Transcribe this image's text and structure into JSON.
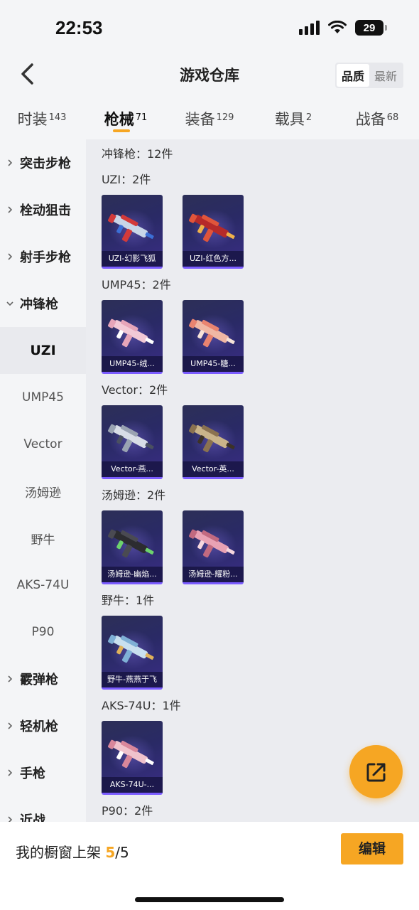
{
  "status_bar": {
    "time": "22:53",
    "battery": "29",
    "icons": [
      "signal-icon",
      "wifi-icon",
      "battery-icon"
    ]
  },
  "header": {
    "title": "游戏仓库",
    "sort_options": [
      {
        "label": "品质",
        "active": true
      },
      {
        "label": "最新",
        "active": false
      }
    ]
  },
  "tabs": [
    {
      "label": "时装",
      "count": "143",
      "active": false
    },
    {
      "label": "枪械",
      "count": "71",
      "active": true
    },
    {
      "label": "装备",
      "count": "129",
      "active": false
    },
    {
      "label": "载具",
      "count": "2",
      "active": false
    },
    {
      "label": "战备",
      "count": "68",
      "active": false
    }
  ],
  "sidebar": {
    "items": [
      {
        "label": "突击步枪",
        "type": "category",
        "expanded": false
      },
      {
        "label": "栓动狙击",
        "type": "category",
        "expanded": false
      },
      {
        "label": "射手步枪",
        "type": "category",
        "expanded": false
      },
      {
        "label": "冲锋枪",
        "type": "category",
        "expanded": true
      },
      {
        "label": "UZI",
        "type": "sub",
        "active": true
      },
      {
        "label": "UMP45",
        "type": "sub",
        "active": false
      },
      {
        "label": "Vector",
        "type": "sub",
        "active": false
      },
      {
        "label": "汤姆逊",
        "type": "sub",
        "active": false
      },
      {
        "label": "野牛",
        "type": "sub",
        "active": false
      },
      {
        "label": "AKS-74U",
        "type": "sub",
        "active": false
      },
      {
        "label": "P90",
        "type": "sub",
        "active": false
      },
      {
        "label": "霰弹枪",
        "type": "category",
        "expanded": false
      },
      {
        "label": "轻机枪",
        "type": "category",
        "expanded": false
      },
      {
        "label": "手枪",
        "type": "category",
        "expanded": false
      },
      {
        "label": "近战",
        "type": "category",
        "expanded": false
      }
    ]
  },
  "content": {
    "category_summary": "冲锋枪：12件",
    "groups": [
      {
        "title": "UZI：2件",
        "items": [
          {
            "label": "UZI-幻影飞狐",
            "palette": [
              "#c8d6e8",
              "#d23a3a",
              "#3b6fd6"
            ]
          },
          {
            "label": "UZI-红色方...",
            "palette": [
              "#b52a2a",
              "#e0553b",
              "#f0b24a"
            ]
          }
        ]
      },
      {
        "title": "UMP45：2件",
        "items": [
          {
            "label": "UMP45-绒...",
            "palette": [
              "#f2c9d6",
              "#e6a5b9",
              "#ffffff"
            ]
          },
          {
            "label": "UMP45-糖...",
            "palette": [
              "#f0b7a4",
              "#e98470",
              "#f6e3d8"
            ]
          }
        ]
      },
      {
        "title": "Vector：2件",
        "items": [
          {
            "label": "Vector-燕...",
            "palette": [
              "#d8dde6",
              "#9aa3b2",
              "#4a5060"
            ]
          },
          {
            "label": "Vector-英...",
            "palette": [
              "#c9b48a",
              "#8a7250",
              "#3c3226"
            ]
          }
        ]
      },
      {
        "title": "汤姆逊：2件",
        "items": [
          {
            "label": "汤姆逊-幽焰...",
            "palette": [
              "#2c2c30",
              "#4a4a52",
              "#6dd36d"
            ]
          },
          {
            "label": "汤姆逊-耀粉...",
            "palette": [
              "#e9a2b4",
              "#c26a80",
              "#f6d7de"
            ]
          }
        ]
      },
      {
        "title": "野牛：1件",
        "items": [
          {
            "label": "野牛-燕燕于飞",
            "palette": [
              "#c9e0ef",
              "#7fb0d6",
              "#e0b25a"
            ]
          }
        ]
      },
      {
        "title": "AKS-74U：1件",
        "items": [
          {
            "label": "AKS-74U-...",
            "palette": [
              "#f0c2cc",
              "#d9879b",
              "#ffffff"
            ]
          }
        ]
      },
      {
        "title": "P90：2件",
        "items": [
          {
            "label": "",
            "palette": [
              "#2c2f57",
              "#3a2e86",
              "#7b5cff"
            ]
          },
          {
            "label": "",
            "palette": [
              "#2c2f57",
              "#3a2e86",
              "#7b5cff"
            ]
          }
        ]
      }
    ]
  },
  "bottom_bar": {
    "showcase_prefix": "我的橱窗上架 ",
    "showcase_current": "5",
    "showcase_total": "/5",
    "edit_label": "编辑"
  },
  "colors": {
    "accent": "#f6a623",
    "card_bg": "#2c2f57",
    "card_border": "#7b5cff"
  }
}
